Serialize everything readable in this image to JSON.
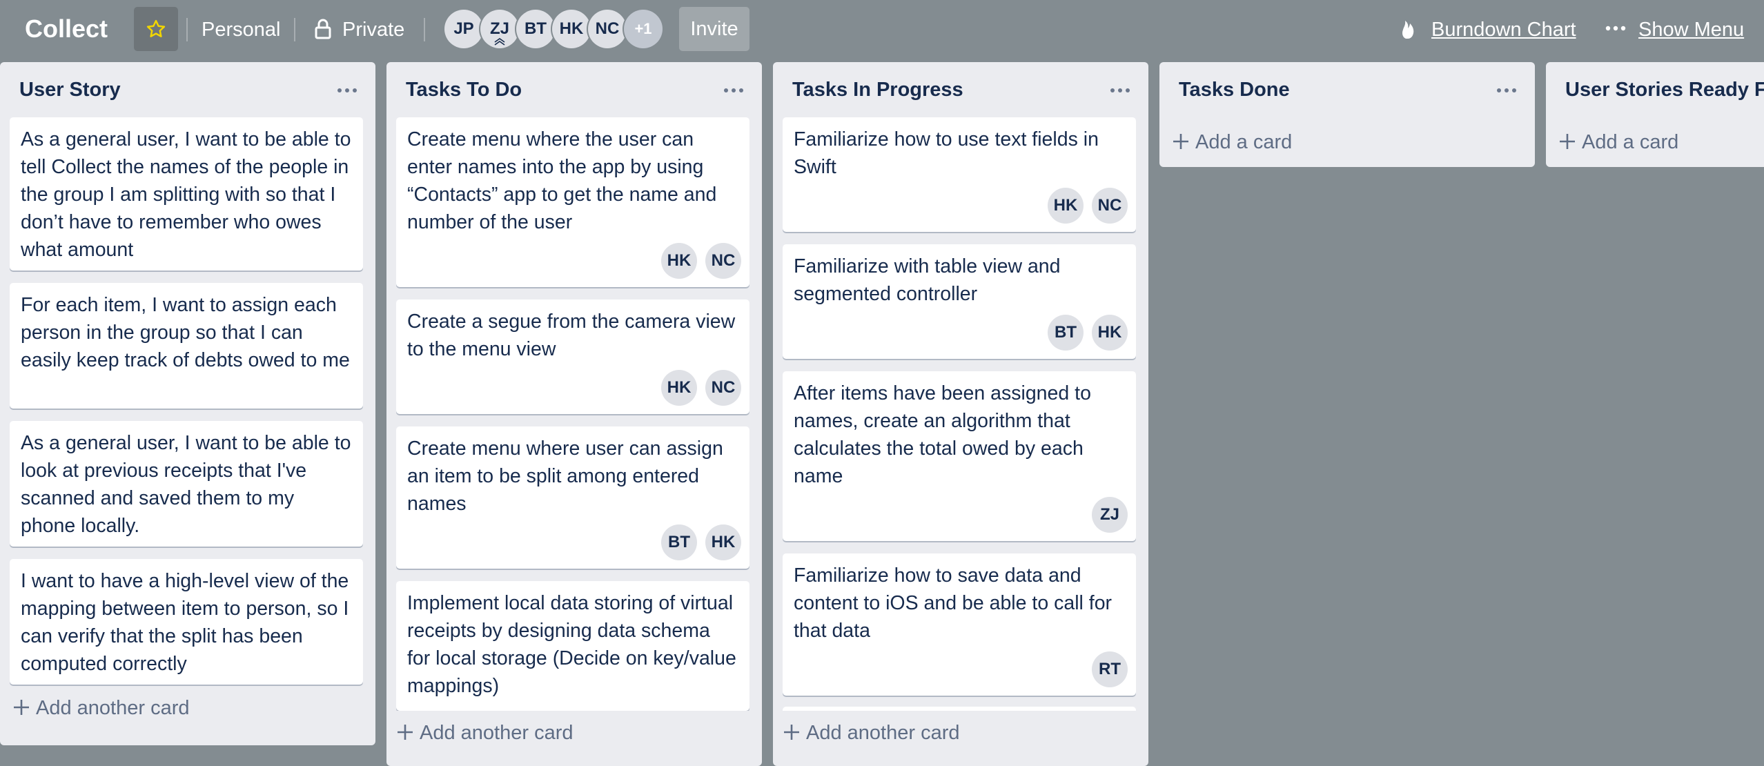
{
  "header": {
    "board_title": "Collect",
    "team": "Personal",
    "visibility": "Private",
    "members": [
      "JP",
      "ZJ",
      "BT",
      "HK",
      "NC"
    ],
    "members_more": "+1",
    "invite_label": "Invite",
    "burndown_label": "Burndown Chart",
    "show_menu_label": "Show Menu",
    "star_color": "#f2d600"
  },
  "lists": [
    {
      "title": "User Story",
      "add_label": "Add another card",
      "cards": [
        {
          "text": "As a general user, I want to be able to tell Collect the names of the people in the group I am splitting with so that I don’t have to remember who owes what amount",
          "members": []
        },
        {
          "text": "For each item, I want to assign each person in the group so that I can easily keep track of debts owed to me",
          "members": []
        },
        {
          "text": "As a general user, I want to be able to look at previous receipts that I've scanned and saved them to my phone locally.",
          "members": []
        },
        {
          "text": "I want to have a high-level view of the mapping between item to person, so I can verify that the split has been computed correctly",
          "members": []
        }
      ]
    },
    {
      "title": "Tasks To Do",
      "add_label": "Add another card",
      "cards": [
        {
          "text": "Create menu where the user can enter names into the app by using “Contacts” app to get the name and number of the user",
          "members": [
            "HK",
            "NC"
          ]
        },
        {
          "text": "Create a segue from the camera view to the menu view",
          "members": [
            "HK",
            "NC"
          ]
        },
        {
          "text": "Create menu where user can assign an item to be split among entered names",
          "members": [
            "BT",
            "HK"
          ]
        },
        {
          "text": "Implement local data storing of virtual receipts by designing data schema for local storage (Decide on key/value mappings)",
          "members": []
        }
      ]
    },
    {
      "title": "Tasks In Progress",
      "add_label": "Add another card",
      "cards": [
        {
          "text": "Familiarize how to use text fields in Swift",
          "members": [
            "HK",
            "NC"
          ]
        },
        {
          "text": "Familiarize with table view and segmented controller",
          "members": [
            "BT",
            "HK"
          ]
        },
        {
          "text": "After items have been assigned to names, create an algorithm that calculates the total owed by each name",
          "members": [
            "ZJ"
          ]
        },
        {
          "text": "Familiarize how to save data and content to iOS and be able to call for that data",
          "members": [
            "RT"
          ]
        }
      ]
    },
    {
      "title": "Tasks Done",
      "add_label": "Add a card",
      "cards": []
    },
    {
      "title": "User Stories Ready Fo",
      "add_label": "Add a card",
      "cards": []
    }
  ]
}
